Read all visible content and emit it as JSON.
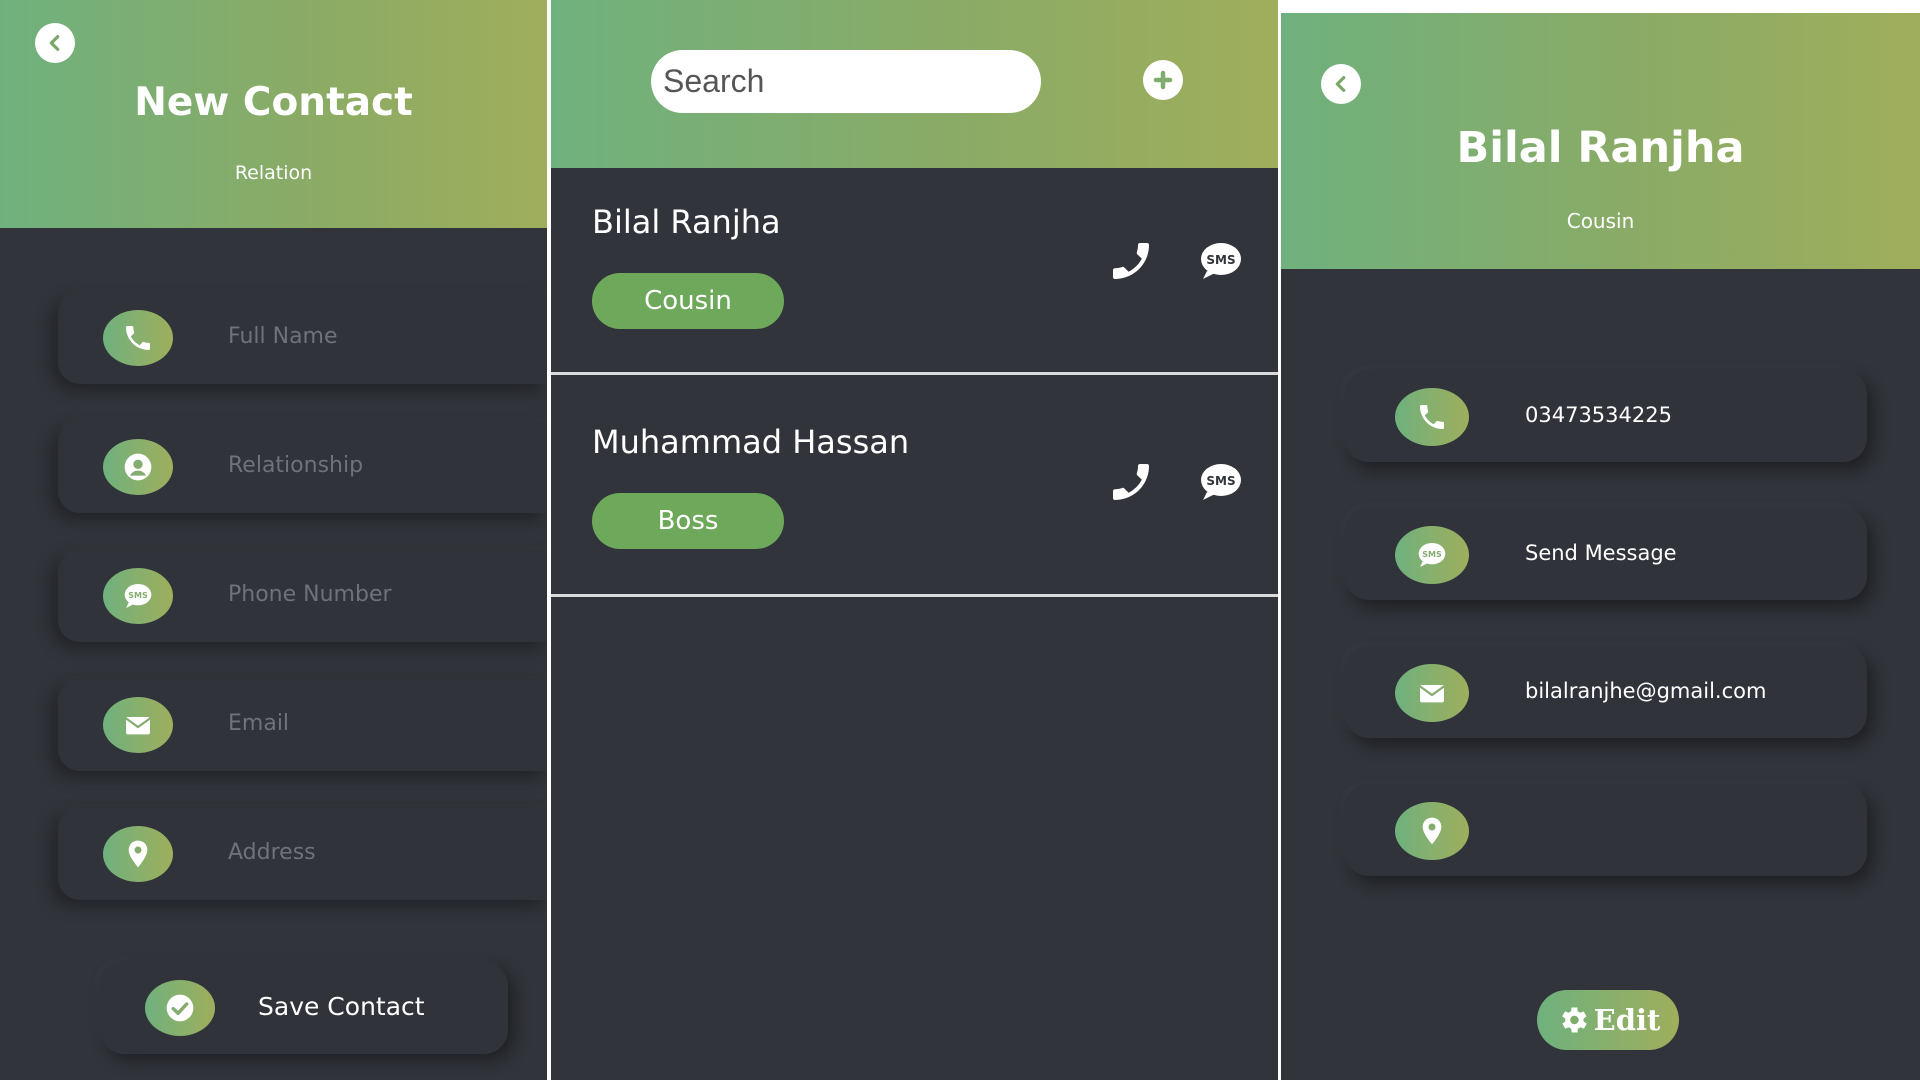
{
  "new_contact": {
    "title": "New Contact",
    "subtitle": "Relation",
    "back_icon": "back-arrow-icon",
    "fields": [
      {
        "icon": "phone-icon",
        "placeholder": "Full Name"
      },
      {
        "icon": "user-icon",
        "placeholder": "Relationship"
      },
      {
        "icon": "sms-icon",
        "placeholder": "Phone Number"
      },
      {
        "icon": "envelope-icon",
        "placeholder": "Email"
      },
      {
        "icon": "location-pin-icon",
        "placeholder": "Address"
      }
    ],
    "save_label": "Save Contact",
    "save_icon": "check-icon"
  },
  "contact_list": {
    "search_placeholder": "Search",
    "add_icon": "plus-icon",
    "contacts": [
      {
        "name": "Bilal Ranjha",
        "relation": "Cousin"
      },
      {
        "name": "Muhammad Hassan",
        "relation": "Boss"
      }
    ]
  },
  "contact_detail": {
    "name": "Bilal Ranjha",
    "relation": "Cousin",
    "phone": "03473534225",
    "message_label": "Send Message",
    "email": "bilalranjhe@gmail.com",
    "address": "",
    "edit_label": "Edit",
    "edit_icon": "gear-icon"
  },
  "colors": {
    "accent_green": "#6ea85a",
    "gradient_start": "#6fb17e",
    "gradient_end": "#9fae5c",
    "background": "#31343a",
    "divider": "#d9dadc"
  }
}
